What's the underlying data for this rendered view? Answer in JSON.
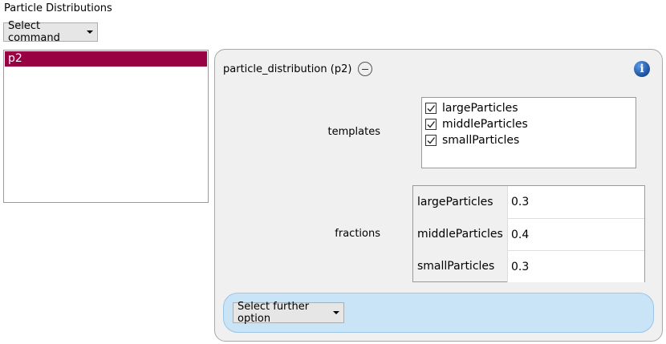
{
  "window": {
    "title": "Particle Distributions"
  },
  "toolbar": {
    "select_command_label": "Select command"
  },
  "list": {
    "items": [
      {
        "label": "p2",
        "selected": true
      }
    ]
  },
  "detail": {
    "header": "particle_distribution (p2)",
    "info_icon": "i",
    "templates": {
      "label": "templates",
      "items": [
        {
          "label": "largeParticles",
          "checked": true
        },
        {
          "label": "middleParticles",
          "checked": true
        },
        {
          "label": "smallParticles",
          "checked": true
        }
      ]
    },
    "fractions": {
      "label": "fractions",
      "rows": [
        {
          "name": "largeParticles",
          "value": "0.3"
        },
        {
          "name": "middleParticles",
          "value": "0.4"
        },
        {
          "name": "smallParticles",
          "value": "0.3"
        }
      ]
    },
    "further_option_label": "Select further option"
  },
  "colors": {
    "selection": "#990044",
    "panel": "#f0f0f0",
    "further_panel": "#c9e3f7"
  }
}
